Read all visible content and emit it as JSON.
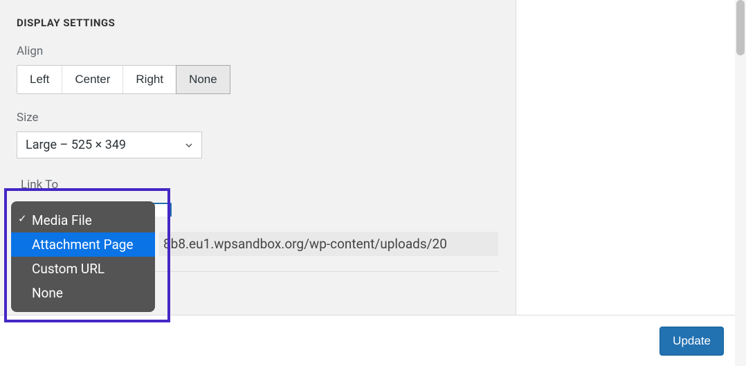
{
  "section": {
    "title": "DISPLAY SETTINGS"
  },
  "align": {
    "label": "Align",
    "options": [
      "Left",
      "Center",
      "Right",
      "None"
    ],
    "selected": "None"
  },
  "size": {
    "label": "Size",
    "selected": "Large – 525 × 349"
  },
  "linkto": {
    "label": "Link To",
    "options": [
      {
        "label": "Media File",
        "checked": true,
        "highlighted": false
      },
      {
        "label": "Attachment Page",
        "checked": false,
        "highlighted": true
      },
      {
        "label": "Custom URL",
        "checked": false,
        "highlighted": false
      },
      {
        "label": "None",
        "checked": false,
        "highlighted": false
      }
    ],
    "url_value": "8b8.eu1.wpsandbox.org/wp-content/uploads/20"
  },
  "footer": {
    "update_label": "Update"
  },
  "colors": {
    "highlight_border": "#4527c6",
    "accent": "#2271b1"
  }
}
